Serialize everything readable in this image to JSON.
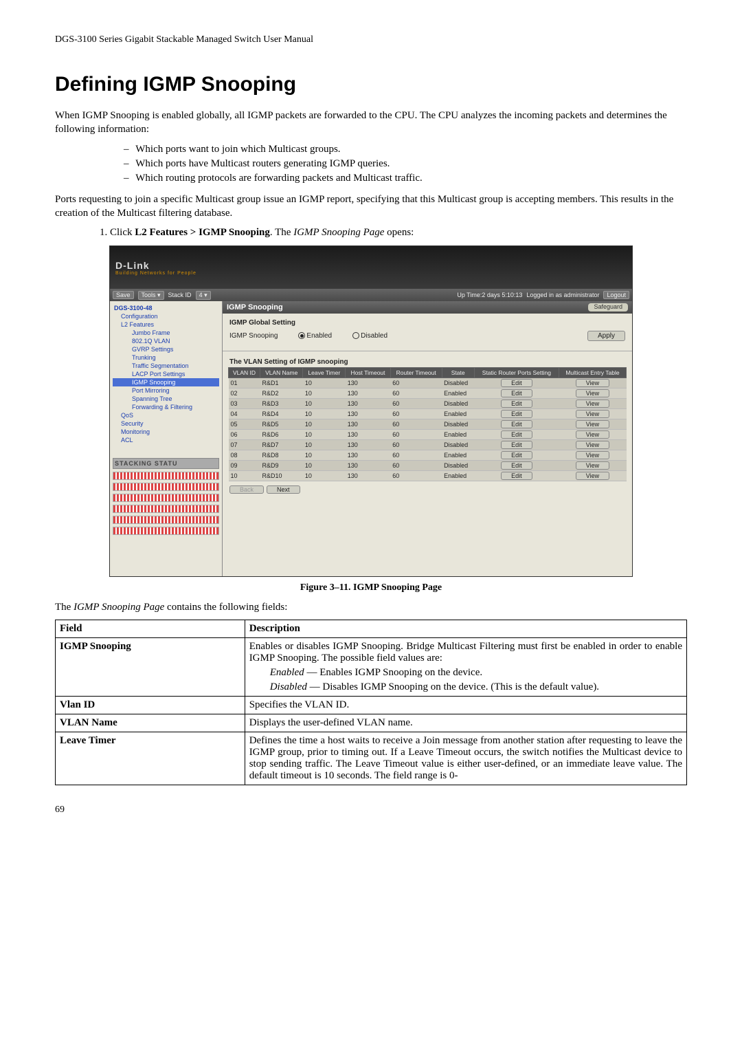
{
  "header": "DGS-3100 Series Gigabit Stackable Managed Switch User Manual",
  "title": "Defining IGMP Snooping",
  "intro": "When IGMP Snooping is enabled globally, all IGMP packets are forwarded to the CPU. The CPU analyzes the incoming packets and determines the following information:",
  "bullets": [
    "Which ports want to join which Multicast groups.",
    "Which ports have Multicast routers generating IGMP queries.",
    "Which routing protocols are forwarding packets and Multicast traffic."
  ],
  "para2": "Ports requesting to join a specific Multicast group issue an IGMP report, specifying that this Multicast group is accepting members. This results in the creation of the Multicast filtering database.",
  "step1_pre": "Click ",
  "step1_bold": "L2 Features > IGMP Snooping",
  "step1_post": ". The ",
  "step1_ital": "IGMP Snooping Page",
  "step1_end": " opens:",
  "ss": {
    "brand": "D-Link",
    "brand_sub": "Building Networks for People",
    "toolbar": {
      "save": "Save",
      "tools": "Tools ▾",
      "stackid_lbl": "Stack ID",
      "stackid_val": "4 ▾",
      "uptime": "Up Time:2 days 5:10:13",
      "logged": "Logged in as administrator",
      "logout": "Logout"
    },
    "tree": [
      {
        "t": "DGS-3100-48",
        "l": 0
      },
      {
        "t": "Configuration",
        "l": 1
      },
      {
        "t": "L2 Features",
        "l": 1
      },
      {
        "t": "Jumbo Frame",
        "l": 2
      },
      {
        "t": "802.1Q VLAN",
        "l": 2
      },
      {
        "t": "GVRP Settings",
        "l": 2
      },
      {
        "t": "Trunking",
        "l": 2
      },
      {
        "t": "Traffic Segmentation",
        "l": 2
      },
      {
        "t": "LACP Port Settings",
        "l": 2
      },
      {
        "t": "IGMP Snooping",
        "l": 2,
        "sel": true
      },
      {
        "t": "Port Mirroring",
        "l": 2
      },
      {
        "t": "Spanning Tree",
        "l": 2
      },
      {
        "t": "Forwarding & Filtering",
        "l": 2
      },
      {
        "t": "QoS",
        "l": 1
      },
      {
        "t": "Security",
        "l": 1
      },
      {
        "t": "Monitoring",
        "l": 1
      },
      {
        "t": "ACL",
        "l": 1
      }
    ],
    "stack_label": "STACKING STATU",
    "panel_title": "IGMP Snooping",
    "safeguard": "Safeguard",
    "glob_title": "IGMP Global Setting",
    "glob_lbl": "IGMP Snooping",
    "opt_enabled": "Enabled",
    "opt_disabled": "Disabled",
    "apply": "Apply",
    "vlan_title": "The VLAN Setting of IGMP snooping",
    "cols": [
      "VLAN ID",
      "VLAN Name",
      "Leave Timer",
      "Host Timeout",
      "Router Timeout",
      "State",
      "Static Router Ports Setting",
      "Multicast Entry Table"
    ],
    "rows": [
      {
        "id": "01",
        "name": "R&D1",
        "leave": "10",
        "host": "130",
        "router": "60",
        "state": "Disabled"
      },
      {
        "id": "02",
        "name": "R&D2",
        "leave": "10",
        "host": "130",
        "router": "60",
        "state": "Enabled"
      },
      {
        "id": "03",
        "name": "R&D3",
        "leave": "10",
        "host": "130",
        "router": "60",
        "state": "Disabled"
      },
      {
        "id": "04",
        "name": "R&D4",
        "leave": "10",
        "host": "130",
        "router": "60",
        "state": "Enabled"
      },
      {
        "id": "05",
        "name": "R&D5",
        "leave": "10",
        "host": "130",
        "router": "60",
        "state": "Disabled"
      },
      {
        "id": "06",
        "name": "R&D6",
        "leave": "10",
        "host": "130",
        "router": "60",
        "state": "Enabled"
      },
      {
        "id": "07",
        "name": "R&D7",
        "leave": "10",
        "host": "130",
        "router": "60",
        "state": "Disabled"
      },
      {
        "id": "08",
        "name": "R&D8",
        "leave": "10",
        "host": "130",
        "router": "60",
        "state": "Enabled"
      },
      {
        "id": "09",
        "name": "R&D9",
        "leave": "10",
        "host": "130",
        "router": "60",
        "state": "Disabled"
      },
      {
        "id": "10",
        "name": "R&D10",
        "leave": "10",
        "host": "130",
        "router": "60",
        "state": "Enabled"
      }
    ],
    "edit": "Edit",
    "view": "View",
    "back": "Back",
    "next": "Next"
  },
  "fig_caption": "Figure 3–11. IGMP Snooping Page",
  "fields_intro_pre": "The ",
  "fields_intro_ital": "IGMP Snooping Page",
  "fields_intro_post": " contains the following fields:",
  "fields": {
    "h1": "Field",
    "h2": "Description",
    "r1f": "IGMP Snooping",
    "r1d1": "Enables or disables IGMP Snooping. Bridge Multicast Filtering must first be enabled in order to enable IGMP Snooping. The possible field values are:",
    "r1d2_em": "Enabled",
    "r1d2": " — Enables IGMP Snooping on the device.",
    "r1d3_em": "Disabled",
    "r1d3": " — Disables IGMP Snooping on the device. (This is the default value).",
    "r2f": "Vlan ID",
    "r2d": "Specifies the VLAN ID.",
    "r3f": "VLAN Name",
    "r3d": "Displays the user-defined VLAN name.",
    "r4f": "Leave Timer",
    "r4d": "Defines the time a host waits to receive a Join message from another station after requesting to leave the IGMP group, prior to timing out. If a Leave Timeout occurs, the switch notifies the Multicast device to stop sending traffic. The Leave Timeout value is either user-defined, or an immediate leave value. The default timeout is 10 seconds. The field range is 0-"
  },
  "pagenum": "69"
}
